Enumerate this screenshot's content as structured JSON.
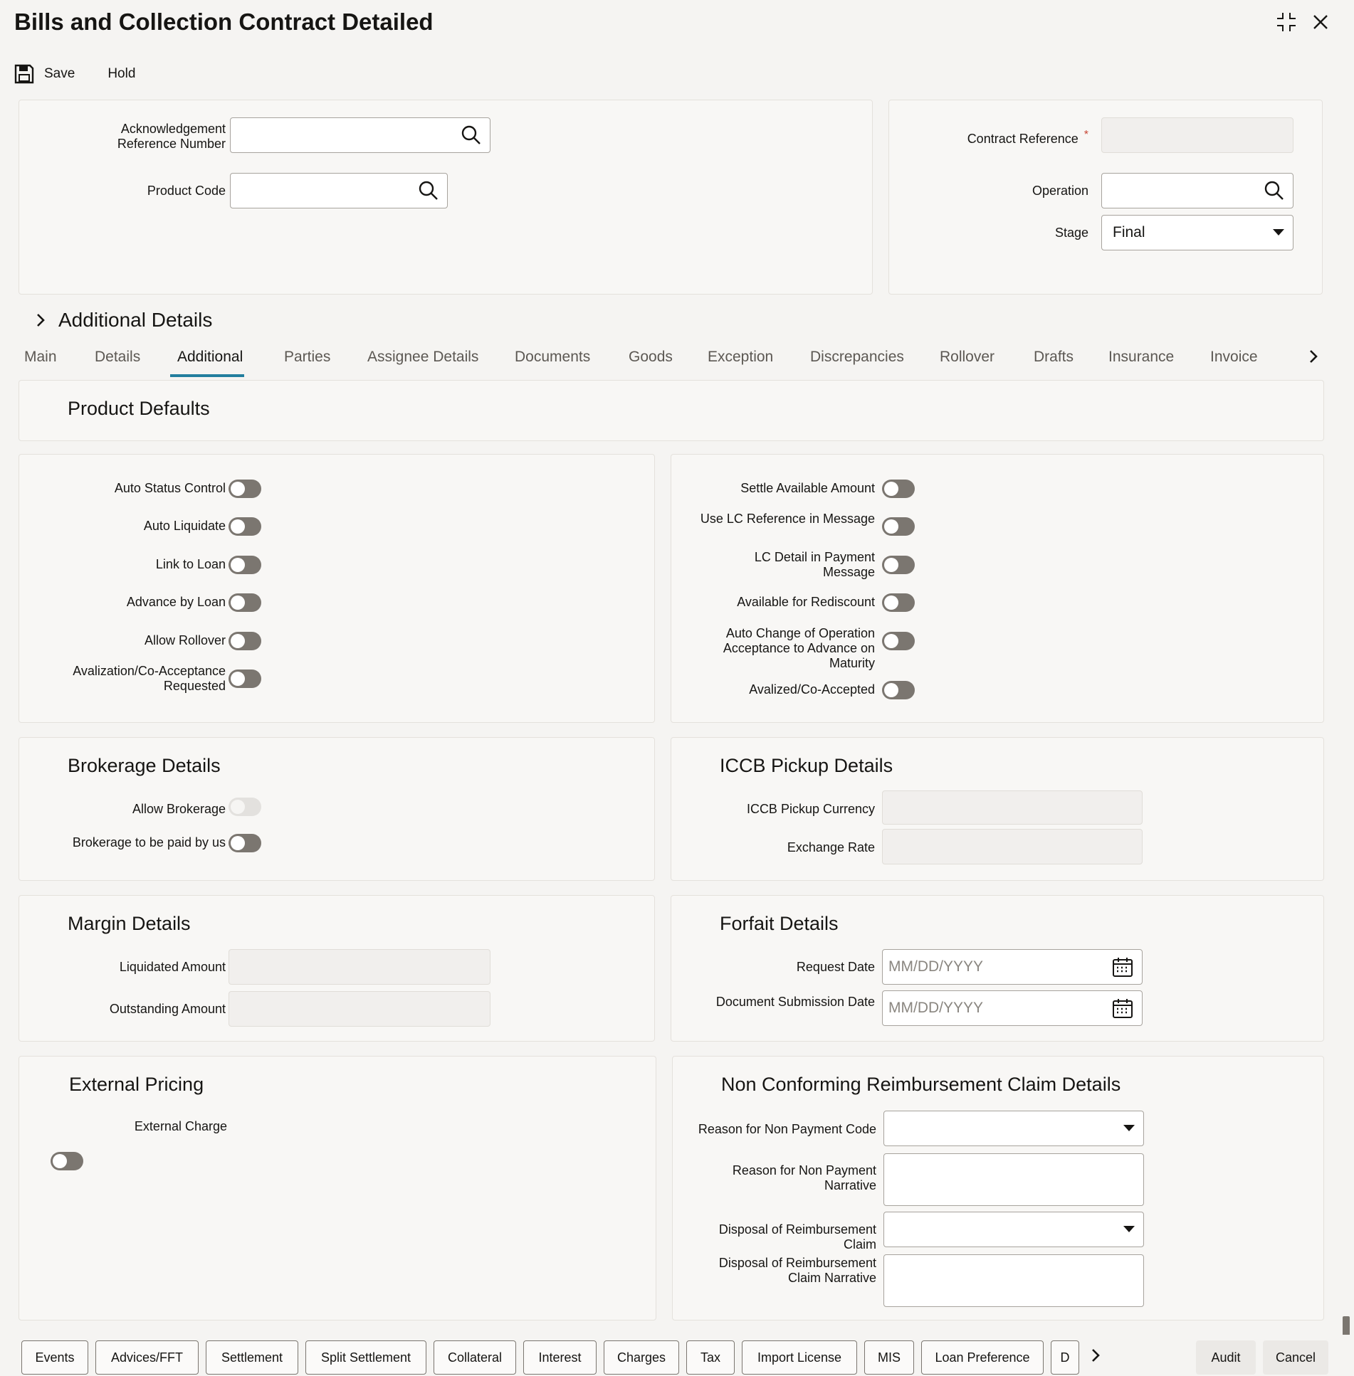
{
  "window": {
    "title": "Bills and Collection Contract Detailed"
  },
  "toolbar": {
    "save_label": "Save",
    "hold_label": "Hold"
  },
  "header": {
    "ack_ref_label": "Acknowledgement Reference Number",
    "ack_ref_value": "",
    "product_code_label": "Product Code",
    "product_code_value": "",
    "contract_ref_label": "Contract Reference",
    "contract_ref_required": "*",
    "contract_ref_value": "",
    "operation_label": "Operation",
    "operation_value": "",
    "stage_label": "Stage",
    "stage_value": "Final"
  },
  "additional_details_label": "Additional Details",
  "tabs": [
    {
      "label": "Main"
    },
    {
      "label": "Details"
    },
    {
      "label": "Additional",
      "active": true
    },
    {
      "label": "Parties"
    },
    {
      "label": "Assignee Details"
    },
    {
      "label": "Documents"
    },
    {
      "label": "Goods"
    },
    {
      "label": "Exception"
    },
    {
      "label": "Discrepancies"
    },
    {
      "label": "Rollover"
    },
    {
      "label": "Drafts"
    },
    {
      "label": "Insurance"
    },
    {
      "label": "Invoice"
    }
  ],
  "product_defaults": {
    "title": "Product Defaults",
    "left": [
      {
        "label": "Auto Status Control",
        "on": false
      },
      {
        "label": "Auto Liquidate",
        "on": false
      },
      {
        "label": "Link to Loan",
        "on": false
      },
      {
        "label": "Advance by Loan",
        "on": false
      },
      {
        "label": "Allow Rollover",
        "on": false
      },
      {
        "label": "Avalization/Co-Acceptance Requested",
        "on": false
      }
    ],
    "right": [
      {
        "label": "Settle Available Amount",
        "on": false
      },
      {
        "label": "Use LC Reference in Message",
        "on": false
      },
      {
        "label": "LC Detail in Payment Message",
        "on": false
      },
      {
        "label": "Available for Rediscount",
        "on": false
      },
      {
        "label": "Auto Change of Operation Acceptance to Advance on Maturity",
        "on": false
      },
      {
        "label": "Avalized/Co-Accepted",
        "on": false
      }
    ]
  },
  "brokerage": {
    "title": "Brokerage Details",
    "allow_brokerage_label": "Allow Brokerage",
    "paid_by_us_label": "Brokerage to be paid by us"
  },
  "iccb": {
    "title": "ICCB Pickup Details",
    "currency_label": "ICCB Pickup Currency",
    "currency_value": "",
    "exchange_rate_label": "Exchange Rate",
    "exchange_rate_value": ""
  },
  "margin": {
    "title": "Margin Details",
    "liquidated_label": "Liquidated Amount",
    "liquidated_value": "",
    "outstanding_label": "Outstanding Amount",
    "outstanding_value": ""
  },
  "forfait": {
    "title": "Forfait Details",
    "request_date_label": "Request Date",
    "request_date_placeholder": "MM/DD/YYYY",
    "doc_submission_label": "Document Submission Date",
    "doc_submission_placeholder": "MM/DD/YYYY"
  },
  "external_pricing": {
    "title": "External Pricing",
    "external_charge_label": "External Charge"
  },
  "non_conforming": {
    "title": "Non Conforming Reimbursement Claim Details",
    "reason_code_label": "Reason for Non Payment Code",
    "reason_narrative_label": "Reason for Non Payment Narrative",
    "disposal_label": "Disposal of Reimbursement Claim",
    "disposal_narrative_label": "Disposal of Reimbursement Claim Narrative"
  },
  "bottom_buttons": [
    "Events",
    "Advices/FFT",
    "Settlement",
    "Split Settlement",
    "Collateral",
    "Interest",
    "Charges",
    "Tax",
    "Import License",
    "MIS",
    "Loan Preference",
    "D"
  ],
  "footer": {
    "audit_label": "Audit",
    "cancel_label": "Cancel"
  },
  "colors": {
    "accent": "#227e9e",
    "required": "#c74634",
    "toggle_off": "#7b7670"
  }
}
